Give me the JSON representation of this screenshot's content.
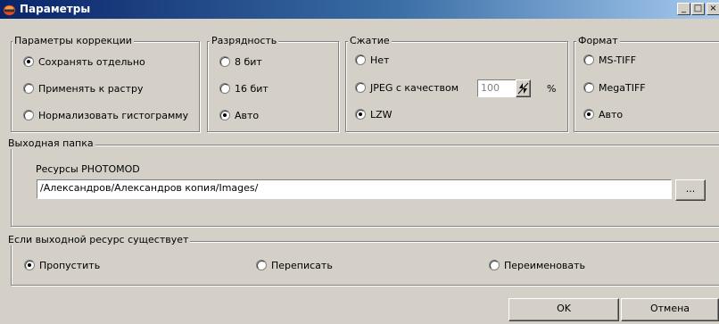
{
  "window": {
    "title": "Параметры",
    "minimize_glyph": "_",
    "maximize_glyph": "□",
    "close_glyph": "×"
  },
  "correction": {
    "title": "Параметры коррекции",
    "options": [
      "Сохранять отдельно",
      "Применять к растру",
      "Нормализовать гистограмму"
    ],
    "selected": "Сохранять отдельно"
  },
  "bitdepth": {
    "title": "Разрядность",
    "options": [
      "8 бит",
      "16 бит",
      "Авто"
    ],
    "selected": "Авто"
  },
  "compression": {
    "title": "Сжатие",
    "options": [
      "Нет",
      "JPEG с качеством",
      "LZW"
    ],
    "selected": "LZW",
    "quality_value": "100",
    "quality_unit": "%"
  },
  "format": {
    "title": "Формат",
    "options": [
      "MS-TIFF",
      "MegaTIFF",
      "Авто"
    ],
    "selected": "Авто"
  },
  "output_folder": {
    "title": "Выходная папка",
    "resource_label": "Ресурсы PHOTOMOD",
    "path_value": "/Александров/Александров копия/Images/",
    "browse_label": "..."
  },
  "if_exists": {
    "title": "Если выходной ресурс существует",
    "options": [
      "Пропустить",
      "Переписать",
      "Переименовать"
    ],
    "selected": "Пропустить"
  },
  "buttons": {
    "ok": "OK",
    "cancel": "Отмена"
  },
  "icons": {
    "app_icon": "photomod-icon",
    "radio": "radio-icon",
    "spin": "spin-arrows-icon"
  },
  "colors": {
    "face": "#d4d0c8",
    "title_start": "#0a246a",
    "title_end": "#a6caf0"
  }
}
